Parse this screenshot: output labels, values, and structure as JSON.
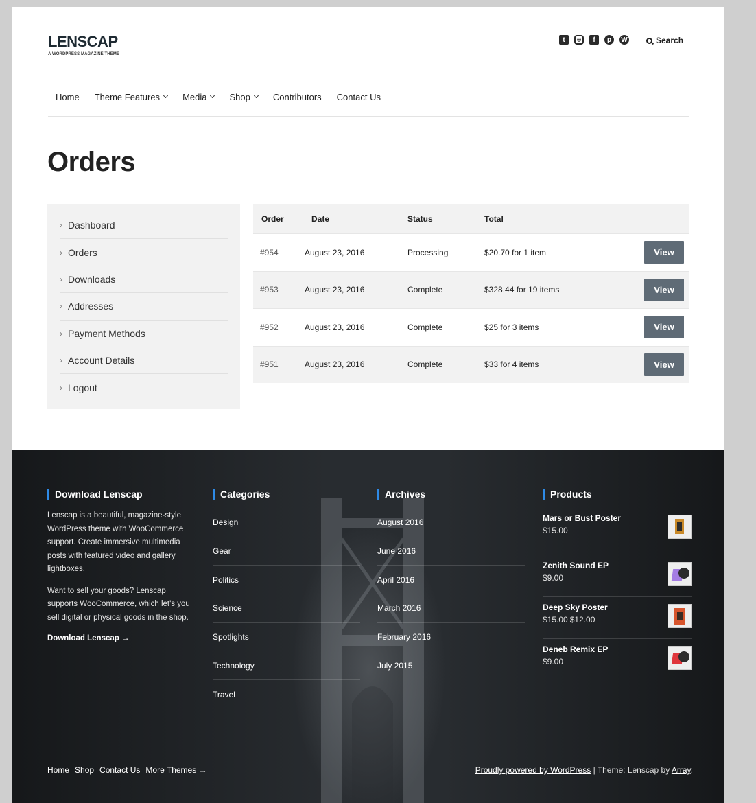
{
  "site": {
    "title": "LENSCAP",
    "tagline": "A WORDPRESS MAGAZINE THEME"
  },
  "header": {
    "social_icons": [
      "twitter-icon",
      "instagram-icon",
      "facebook-icon",
      "pinterest-icon",
      "wordpress-icon"
    ],
    "search_label": "Search"
  },
  "nav": {
    "home": "Home",
    "theme_features": "Theme Features",
    "media": "Media",
    "shop": "Shop",
    "contributors": "Contributors",
    "contact_us": "Contact Us"
  },
  "page_title": "Orders",
  "account_nav": [
    {
      "label": "Dashboard"
    },
    {
      "label": "Orders"
    },
    {
      "label": "Downloads"
    },
    {
      "label": "Addresses"
    },
    {
      "label": "Payment Methods"
    },
    {
      "label": "Account Details"
    },
    {
      "label": "Logout"
    }
  ],
  "orders": {
    "columns": {
      "order": "Order",
      "date": "Date",
      "status": "Status",
      "total": "Total"
    },
    "view_label": "View",
    "rows": [
      {
        "order": "#954",
        "date": "August 23, 2016",
        "status": "Processing",
        "total": "$20.70 for 1 item"
      },
      {
        "order": "#953",
        "date": "August 23, 2016",
        "status": "Complete",
        "total": "$328.44 for 19 items"
      },
      {
        "order": "#952",
        "date": "August 23, 2016",
        "status": "Complete",
        "total": "$25 for 3 items"
      },
      {
        "order": "#951",
        "date": "August 23, 2016",
        "status": "Complete",
        "total": "$33 for 4 items"
      }
    ]
  },
  "footer": {
    "download": {
      "heading": "Download Lenscap",
      "para1": "Lenscap is a beautiful, magazine-style WordPress theme with WooCommerce support. Create immersive multimedia posts with featured video and gallery lightboxes.",
      "para2": "Want to sell your goods? Lenscap supports WooCommerce, which let's you sell digital or physical goods in the shop.",
      "link": "Download Lenscap →"
    },
    "categories": {
      "heading": "Categories",
      "items": [
        "Design",
        "Gear",
        "Politics",
        "Science",
        "Spotlights",
        "Technology",
        "Travel"
      ]
    },
    "archives": {
      "heading": "Archives",
      "items": [
        "August 2016",
        "June 2016",
        "April 2016",
        "March 2016",
        "February 2016",
        "July 2015"
      ]
    },
    "products": {
      "heading": "Products",
      "items": [
        {
          "name": "Mars or Bust Poster",
          "price": "$15.00",
          "old_price": ""
        },
        {
          "name": "Zenith Sound EP",
          "price": "$9.00",
          "old_price": ""
        },
        {
          "name": "Deep Sky Poster",
          "price": "$12.00",
          "old_price": "$15.00"
        },
        {
          "name": "Deneb Remix EP",
          "price": "$9.00",
          "old_price": ""
        }
      ]
    },
    "bottom_nav": [
      "Home",
      "Shop",
      "Contact Us",
      "More Themes →"
    ],
    "credit": {
      "powered": "Proudly powered by WordPress",
      "separator": " | Theme: Lenscap by ",
      "author": "Array",
      "end": "."
    }
  }
}
